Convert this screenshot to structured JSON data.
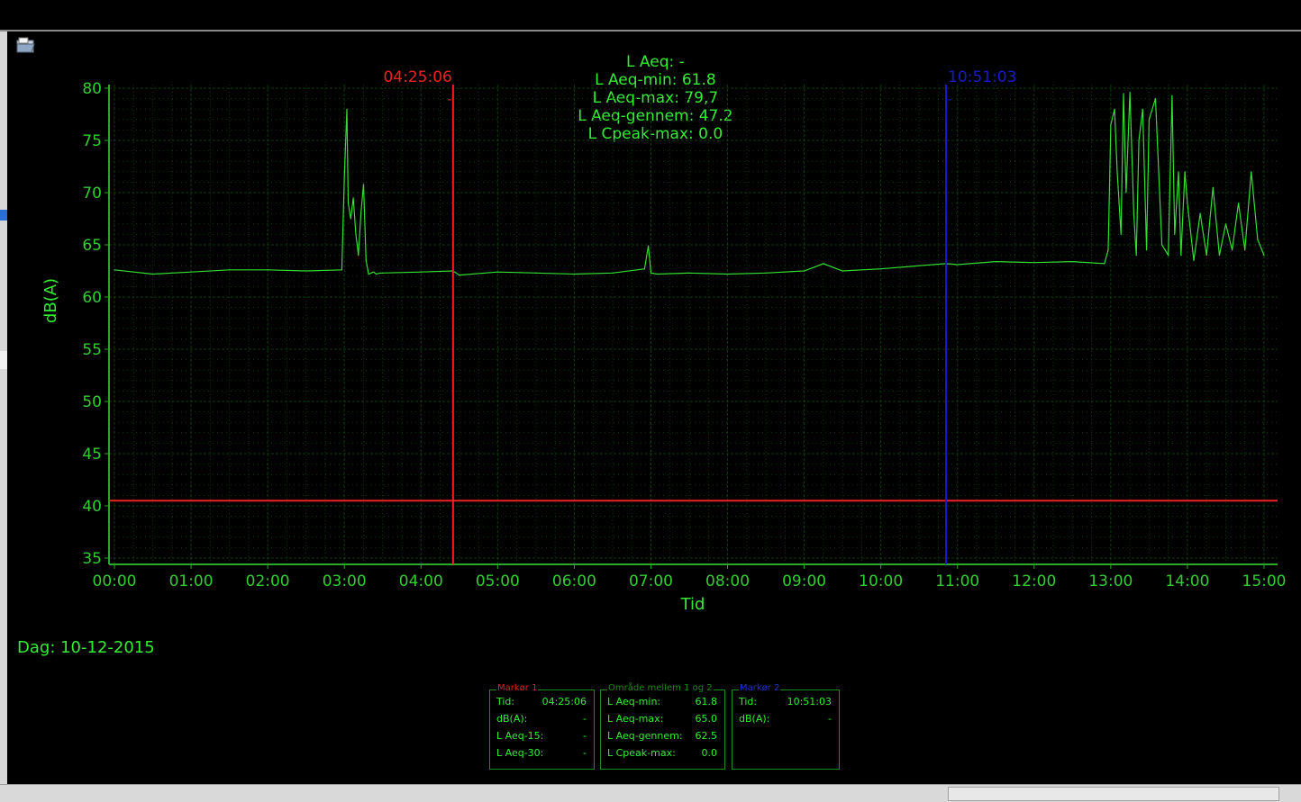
{
  "header": {
    "stats": [
      "L Aeq: -",
      "L Aeq-min: 61.8",
      "L Aeq-max: 79,7",
      "L Aeq-gennem: 47.2",
      "L Cpeak-max: 0.0"
    ]
  },
  "chart_data": {
    "type": "line",
    "title": "",
    "xlabel": "Tid",
    "ylabel": "dB(A)",
    "ylim": [
      35,
      80
    ],
    "xlim_hours": [
      0,
      15
    ],
    "x_ticks": [
      "00:00",
      "01:00",
      "02:00",
      "03:00",
      "04:00",
      "05:00",
      "06:00",
      "07:00",
      "08:00",
      "09:00",
      "10:00",
      "11:00",
      "12:00",
      "13:00",
      "14:00",
      "15:00"
    ],
    "y_ticks": [
      80,
      75,
      70,
      65,
      60,
      55,
      50,
      45,
      40,
      35
    ],
    "grid": true,
    "series": [
      {
        "color": "#33dd33",
        "x": [
          "00:00",
          "00:30",
          "01:00",
          "01:30",
          "02:00",
          "02:30",
          "02:58",
          "03:00",
          "03:02",
          "03:03",
          "03:05",
          "03:07",
          "03:09",
          "03:11",
          "03:13",
          "03:15",
          "03:17",
          "03:19",
          "03:21",
          "03:23",
          "03:25",
          "03:28",
          "03:30",
          "04:00",
          "04:25",
          "04:30",
          "05:00",
          "05:30",
          "06:00",
          "06:30",
          "06:55",
          "06:58",
          "07:00",
          "07:05",
          "07:30",
          "08:00",
          "08:30",
          "09:00",
          "09:15",
          "09:30",
          "10:00",
          "10:30",
          "10:51",
          "11:00",
          "11:30",
          "12:00",
          "12:30",
          "12:55",
          "12:58",
          "13:00",
          "13:03",
          "13:05",
          "13:08",
          "13:10",
          "13:12",
          "13:15",
          "13:18",
          "13:20",
          "13:22",
          "13:25",
          "13:28",
          "13:30",
          "13:35",
          "13:40",
          "13:45",
          "13:48",
          "13:50",
          "13:53",
          "13:55",
          "13:58",
          "14:00",
          "14:05",
          "14:10",
          "14:15",
          "14:20",
          "14:25",
          "14:30",
          "14:35",
          "14:40",
          "14:45",
          "14:50",
          "14:55",
          "15:00"
        ],
        "y": [
          62.6,
          62.2,
          62.4,
          62.6,
          62.6,
          62.5,
          62.6,
          71.5,
          78,
          69,
          67.5,
          69.5,
          66,
          64,
          68,
          70.8,
          63.5,
          62.2,
          62.3,
          62.4,
          62.2,
          62.3,
          62.3,
          62.4,
          62.5,
          62.1,
          62.4,
          62.3,
          62.2,
          62.3,
          62.7,
          64.9,
          62.3,
          62.2,
          62.3,
          62.2,
          62.3,
          62.5,
          63.2,
          62.5,
          62.7,
          63.0,
          63.2,
          63.1,
          63.4,
          63.3,
          63.4,
          63.2,
          64.5,
          76.5,
          78,
          72,
          66,
          79.5,
          70,
          79.6,
          68,
          64,
          75,
          78,
          64.5,
          77,
          79,
          65,
          64,
          79.3,
          66,
          72,
          64,
          72,
          69,
          63.5,
          68,
          64,
          70.5,
          64,
          67,
          64.5,
          69,
          64.5,
          72,
          65.5,
          64
        ]
      }
    ],
    "reference_line": {
      "value": 40.5,
      "color": "#ee2222"
    },
    "markers": [
      {
        "name": "Markør 1",
        "time": "04:25:06",
        "color": "#ee2222",
        "sub": "-"
      },
      {
        "name": "Markør 2",
        "time": "10:51:03",
        "color": "#1a1acc",
        "sub": "-"
      }
    ]
  },
  "day": "Dag: 10-12-2015",
  "panels": {
    "marker1": {
      "title": "Markør 1",
      "title_color": "#dd2222",
      "rows": [
        {
          "label": "Tid:",
          "value": "04:25:06"
        },
        {
          "label": "dB(A):",
          "value": "-"
        },
        {
          "label": "L Aeq-15:",
          "value": "-"
        },
        {
          "label": "L Aeq-30:",
          "value": "-"
        }
      ]
    },
    "range": {
      "title": "Område mellem 1 og 2",
      "title_color": "#1f8a1f",
      "rows": [
        {
          "label": "L Aeq-min:",
          "value": "61.8"
        },
        {
          "label": "L Aeq-max:",
          "value": "65.0"
        },
        {
          "label": "L Aeq-gennem:",
          "value": "62.5"
        },
        {
          "label": "L Cpeak-max:",
          "value": "0.0"
        }
      ]
    },
    "marker2": {
      "title": "Markør 2",
      "title_color": "#2233cc",
      "rows": [
        {
          "label": "Tid:",
          "value": "10:51:03"
        },
        {
          "label": "dB(A):",
          "value": "-"
        }
      ]
    }
  }
}
